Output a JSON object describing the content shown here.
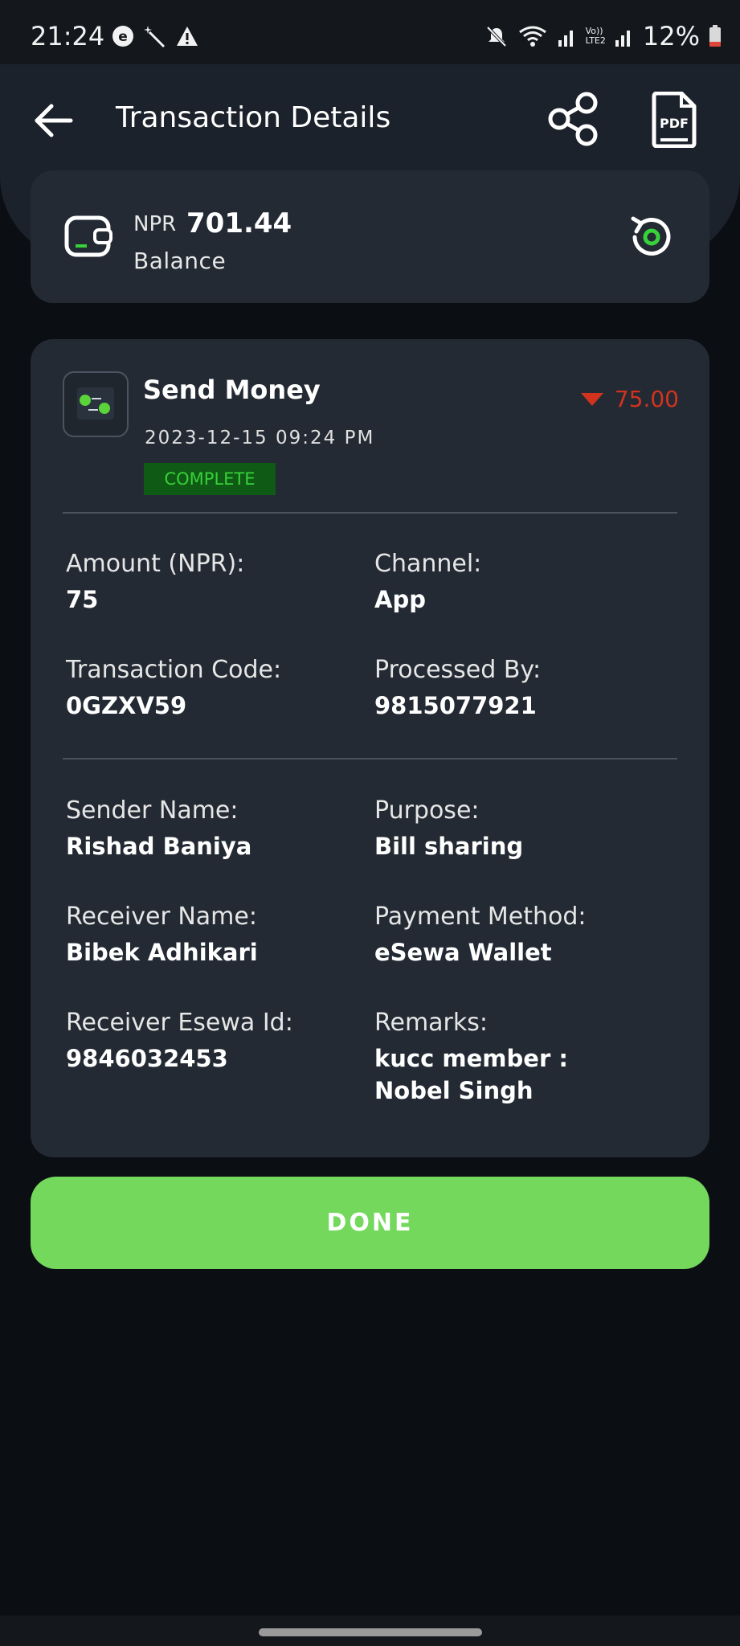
{
  "status_bar": {
    "time": "21:24",
    "battery": "12%",
    "left_icons": [
      "esewa-notification-icon",
      "magic-wand-icon",
      "warning-icon"
    ],
    "right_icons": [
      "mute-icon",
      "wifi-icon",
      "signal-icon",
      "volte-icon",
      "signal-icon",
      "battery-icon"
    ],
    "volte_label_top": "Vo))",
    "volte_label_bottom": "LTE2"
  },
  "app_bar": {
    "title": "Transaction Details",
    "pdf_label": "PDF"
  },
  "balance": {
    "currency": "NPR",
    "value": "701.44",
    "label": "Balance"
  },
  "transaction": {
    "type": "Send Money",
    "date": "2023-12-15 09:24 PM",
    "status": "COMPLETE",
    "amount": "75.00",
    "colors": {
      "debit": "#d2331f",
      "status_bg": "#0f5a14",
      "status_text": "#37d13a"
    }
  },
  "details_group_1": [
    {
      "label": "Amount (NPR):",
      "value": "75"
    },
    {
      "label": "Channel:",
      "value": "App"
    },
    {
      "label": "Transaction Code:",
      "value": "0GZXV59"
    },
    {
      "label": "Processed By:",
      "value": "9815077921"
    }
  ],
  "details_group_2": [
    {
      "label": "Sender Name:",
      "value": "Rishad Baniya"
    },
    {
      "label": "Purpose:",
      "value": "Bill sharing"
    },
    {
      "label": "Receiver Name:",
      "value": "Bibek Adhikari"
    },
    {
      "label": "Payment Method:",
      "value": "eSewa Wallet"
    },
    {
      "label": "Receiver Esewa Id:",
      "value": "9846032453"
    },
    {
      "label": "Remarks:",
      "value": "kucc member : Nobel Singh"
    }
  ],
  "done_button": {
    "label": "DONE",
    "color": "#73d85c"
  }
}
